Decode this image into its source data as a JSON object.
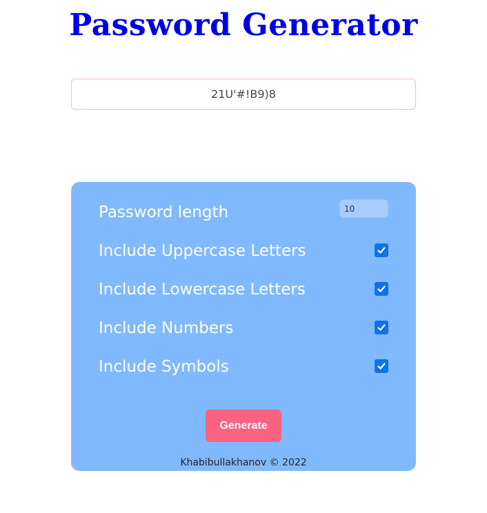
{
  "header": {
    "title": "Password Generator"
  },
  "output": {
    "password": "21U'#!B9)8"
  },
  "settings": {
    "length_label": "Password length",
    "length_value": "10",
    "options": [
      {
        "label": "Include Uppercase Letters",
        "checked": true
      },
      {
        "label": "Include Lowercase Letters",
        "checked": true
      },
      {
        "label": "Include Numbers",
        "checked": true
      },
      {
        "label": "Include Symbols",
        "checked": true
      }
    ],
    "generate_label": "Generate"
  },
  "footer": {
    "text": "Khabibullakhanov © 2022"
  },
  "colors": {
    "title": "#0000e6",
    "panel": "#80b9fe",
    "button": "#fa6282",
    "checkbox": "#1171e8"
  },
  "icons": {
    "checkbox": "checkmark-icon"
  }
}
